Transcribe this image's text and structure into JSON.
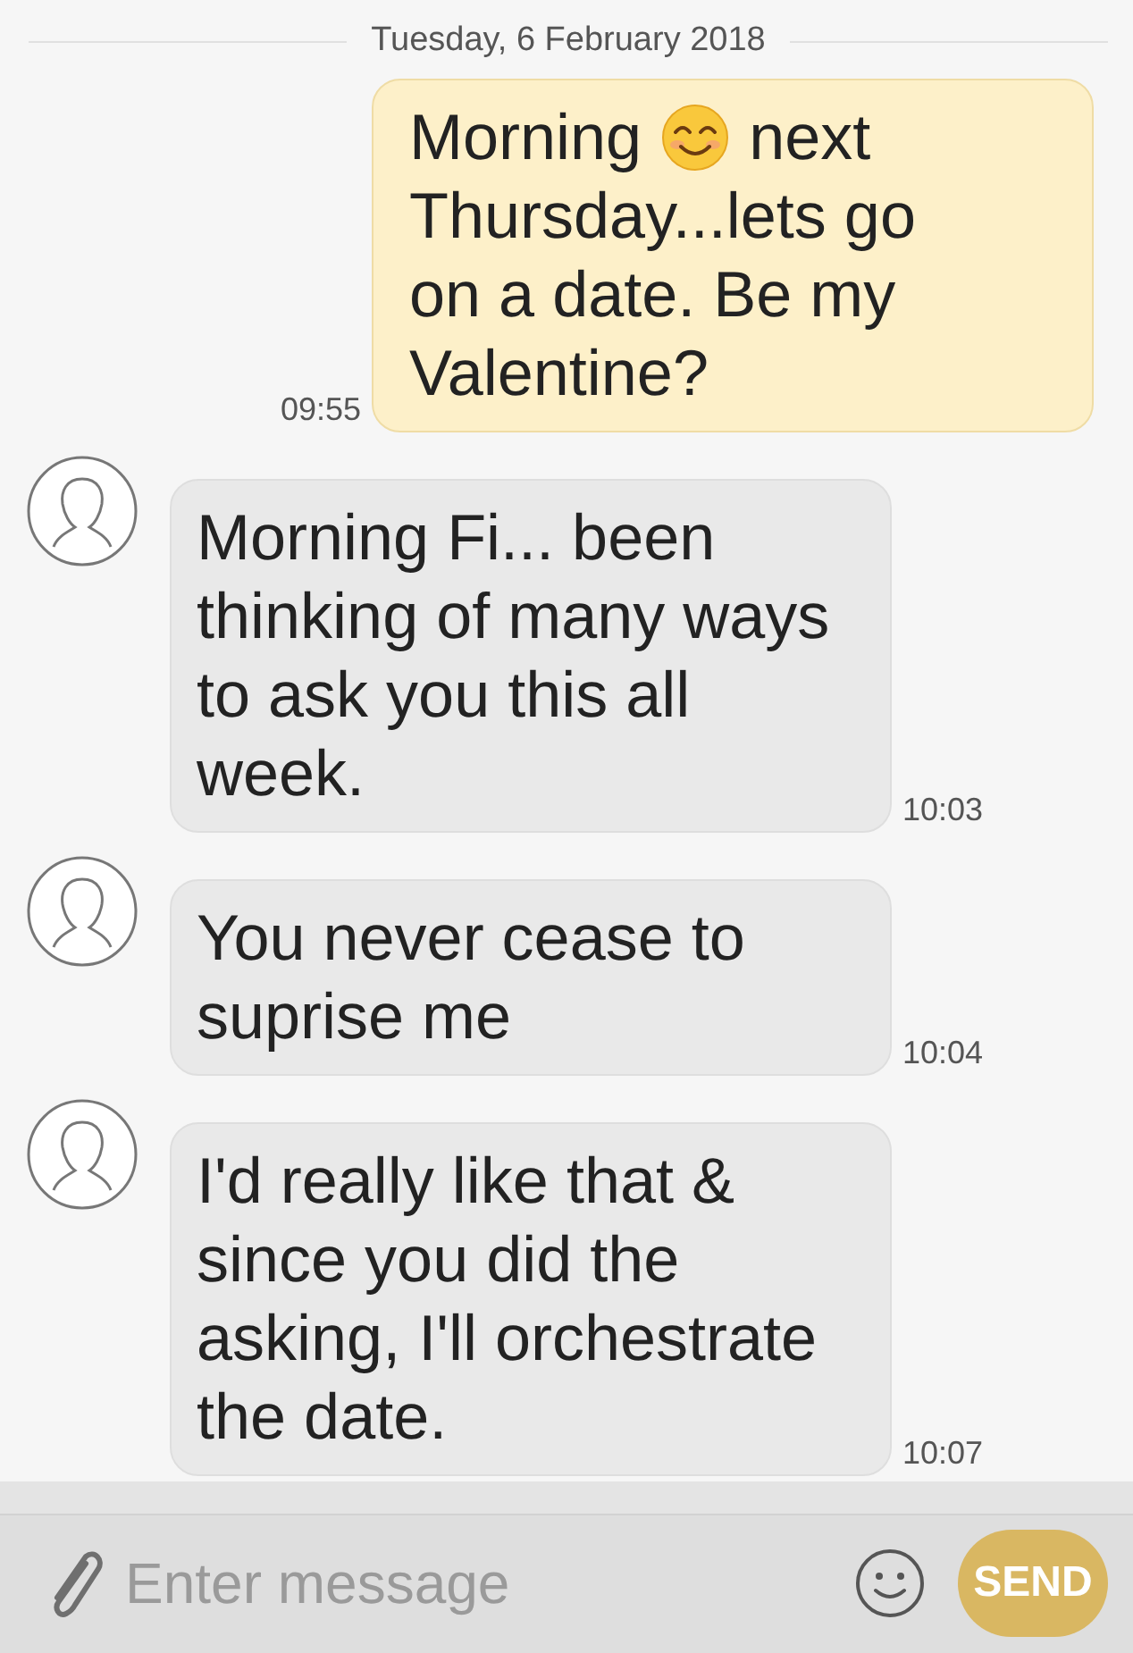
{
  "date_divider": "Tuesday, 6 February 2018",
  "messages": [
    {
      "kind": "outgoing",
      "text_before_emoji": "Morning",
      "text_after_emoji": "next",
      "text_continued": "Thursday...lets go on a date. Be my Valentine?",
      "time": "09:55"
    },
    {
      "kind": "incoming",
      "text": "Morning Fi... been thinking of many ways to ask you this all week.",
      "time": "10:03"
    },
    {
      "kind": "incoming",
      "text": "You never cease to suprise me",
      "time": "10:04"
    },
    {
      "kind": "incoming",
      "text": "I'd really like that & since you did the asking, I'll orchestrate the date.",
      "time": "10:07"
    }
  ],
  "compose": {
    "placeholder": "Enter message",
    "send_label": "SEND",
    "send_disabled": true
  }
}
